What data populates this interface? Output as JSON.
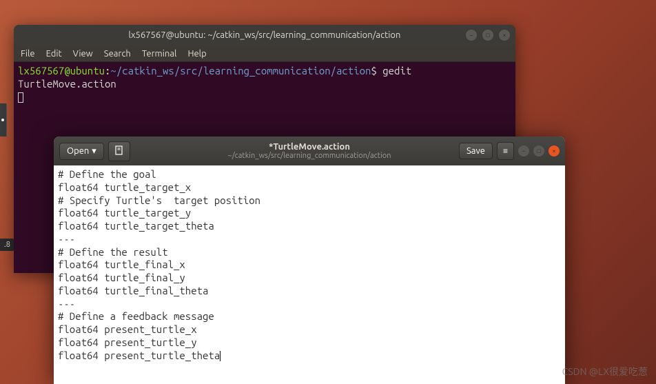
{
  "desktop": {
    "badge": ".8"
  },
  "terminal": {
    "title": "lx567567@ubuntu: ~/catkin_ws/src/learning_communication/action",
    "menu": {
      "file": "File",
      "edit": "Edit",
      "view": "View",
      "search": "Search",
      "terminal": "Terminal",
      "help": "Help"
    },
    "prompt": {
      "user_host": "lx567567@ubuntu",
      "colon": ":",
      "path": "~/catkin_ws/src/learning_communication/action",
      "end": "$",
      "command": " gedit TurtleMove.action"
    }
  },
  "gedit": {
    "open_label": "Open",
    "save_label": "Save",
    "title": "*TurtleMove.action",
    "subtitle": "~/catkin_ws/src/learning_communication/action",
    "content": "# Define the goal\nfloat64 turtle_target_x\n# Specify Turtle's  target position\nfloat64 turtle_target_y\nfloat64 turtle_target_theta\n---\n# Define the result\nfloat64 turtle_final_x\nfloat64 turtle_final_y\nfloat64 turtle_final_theta\n---\n# Define a feedback message\nfloat64 present_turtle_x\nfloat64 present_turtle_y\nfloat64 present_turtle_theta"
  },
  "watermark": "CSDN @LX很爱吃葱"
}
